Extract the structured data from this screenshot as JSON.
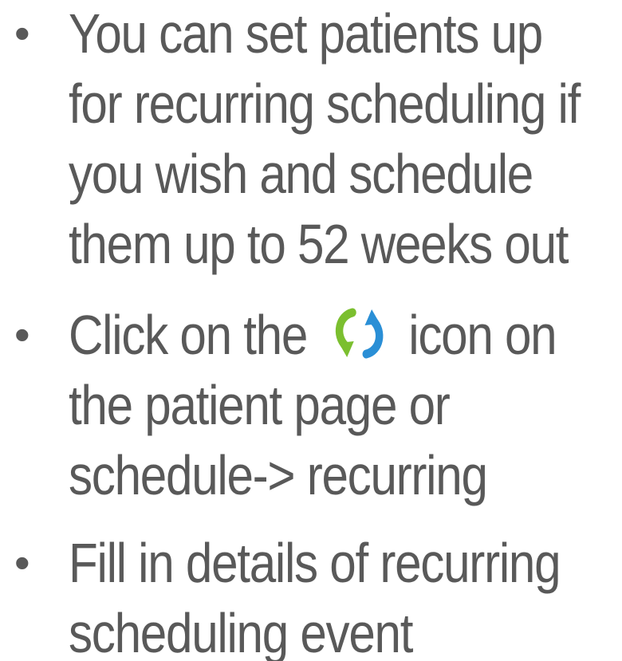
{
  "bullets": [
    {
      "lines": [
        "You can set patients up",
        "for recurring scheduling if",
        "you wish and schedule",
        "them up to 52 weeks out"
      ]
    },
    {
      "line1_before_icon": "Click on the",
      "line1_after_icon": "icon on",
      "icon": "recurring-icon",
      "lines_rest": [
        "the patient page or",
        "schedule-> recurring"
      ]
    },
    {
      "lines": [
        "Fill in details of recurring",
        "scheduling event"
      ]
    }
  ],
  "colors": {
    "text": "#595959",
    "icon_green": "#7bbf2f",
    "icon_blue": "#2a8fd6"
  }
}
